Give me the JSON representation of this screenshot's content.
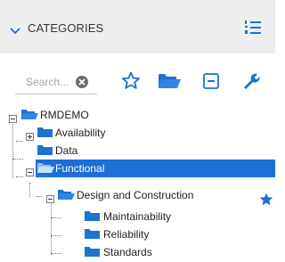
{
  "panel": {
    "title": "CATEGORIES",
    "collapse_icon": "chevron-down-icon",
    "list_icon": "numbered-list-icon"
  },
  "toolbar": {
    "search_placeholder": "Search...",
    "clear_icon": "clear-icon",
    "buttons": [
      "favorite-star-icon",
      "folder-open-icon",
      "collapse-all-icon",
      "wrench-icon"
    ]
  },
  "tree": {
    "root": "RMDEMO",
    "items": {
      "availability": "Availability",
      "data": "Data",
      "functional": "Functional",
      "design": "Design and Construction",
      "maintainability": "Maintainability",
      "reliability": "Reliability",
      "standards": "Standards"
    },
    "selected": "Functional"
  },
  "colors": {
    "accent": "#1d6fd6",
    "folder": "#1e73d0",
    "header_bg": "#eeeeee"
  }
}
